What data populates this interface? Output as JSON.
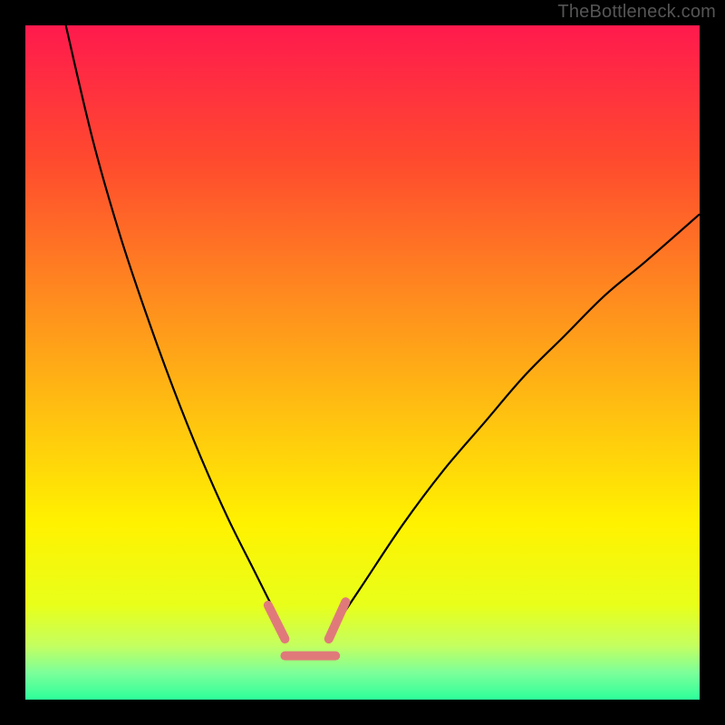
{
  "watermark": "TheBottleneck.com",
  "chart_data": {
    "type": "line",
    "title": "",
    "xlabel": "",
    "ylabel": "",
    "xlim": [
      0,
      100
    ],
    "ylim": [
      0,
      100
    ],
    "grid": false,
    "legend": false,
    "background": {
      "direction": "vertical",
      "stops": [
        {
          "pos": 0.0,
          "color": "#FF1A4D"
        },
        {
          "pos": 0.2,
          "color": "#FF4A2E"
        },
        {
          "pos": 0.4,
          "color": "#FF8A1F"
        },
        {
          "pos": 0.58,
          "color": "#FFC210"
        },
        {
          "pos": 0.74,
          "color": "#FFF200"
        },
        {
          "pos": 0.86,
          "color": "#E8FF1A"
        },
        {
          "pos": 0.92,
          "color": "#C4FF60"
        },
        {
          "pos": 0.96,
          "color": "#7CFF9A"
        },
        {
          "pos": 1.0,
          "color": "#2DFF9A"
        }
      ]
    },
    "series": [
      {
        "name": "curve-left",
        "stroke": "#000000",
        "width": 2.2,
        "x": [
          6,
          10,
          14,
          18,
          22,
          26,
          30,
          34,
          37.5
        ],
        "y": [
          100,
          83,
          69,
          57,
          46,
          36,
          27,
          19,
          12
        ]
      },
      {
        "name": "curve-right",
        "stroke": "#000000",
        "width": 2.2,
        "x": [
          46,
          50,
          56,
          62,
          68,
          74,
          80,
          86,
          92,
          100
        ],
        "y": [
          11,
          17,
          26,
          34,
          41,
          48,
          54,
          60,
          65,
          72
        ]
      },
      {
        "name": "marker-segments",
        "stroke": "#E07A7A",
        "width": 10,
        "linecap": "round",
        "segments": [
          {
            "x": [
              36.0,
              38.5
            ],
            "y": [
              14.0,
              9.0
            ]
          },
          {
            "x": [
              38.5,
              46.0
            ],
            "y": [
              6.5,
              6.5
            ]
          },
          {
            "x": [
              45.0,
              47.5
            ],
            "y": [
              9.0,
              14.5
            ]
          }
        ]
      }
    ]
  }
}
